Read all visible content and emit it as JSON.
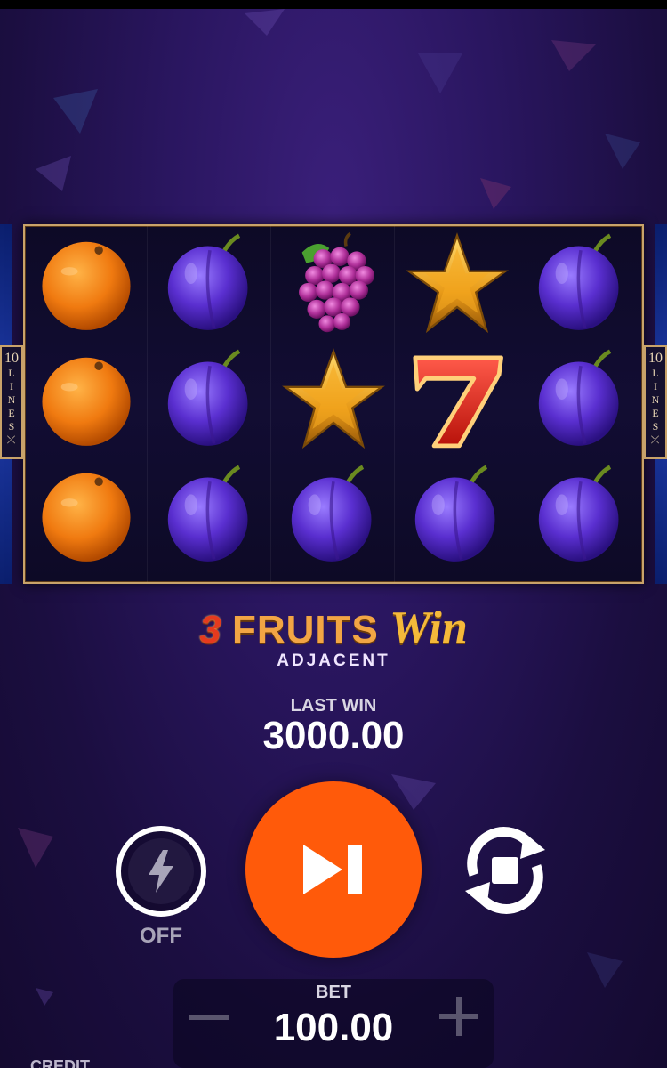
{
  "game": {
    "title_number": "3",
    "title_word": "FRUITS",
    "title_script": "Win",
    "subtitle": "ADJACENT",
    "lines_count": "10",
    "lines_word": "LINES"
  },
  "reels": [
    [
      "orange",
      "orange",
      "orange"
    ],
    [
      "plum",
      "plum",
      "plum"
    ],
    [
      "grapes",
      "star",
      "plum"
    ],
    [
      "star",
      "seven",
      "plum"
    ],
    [
      "plum",
      "plum",
      "plum"
    ]
  ],
  "last_win": {
    "label": "LAST WIN",
    "value": "3000.00"
  },
  "turbo": {
    "label": "OFF",
    "icon": "lightning-icon"
  },
  "spin": {
    "icon": "skip-play-icon"
  },
  "autoplay": {
    "icon": "autoplay-stop-icon"
  },
  "bet": {
    "label": "BET",
    "value": "100.00",
    "minus_icon": "minus-icon",
    "plus_icon": "plus-icon"
  },
  "credit": {
    "label": "CREDIT"
  },
  "colors": {
    "spin_button": "#ff5a0a",
    "frame_gold": "#c9a36a",
    "background": "#1b0e40"
  }
}
